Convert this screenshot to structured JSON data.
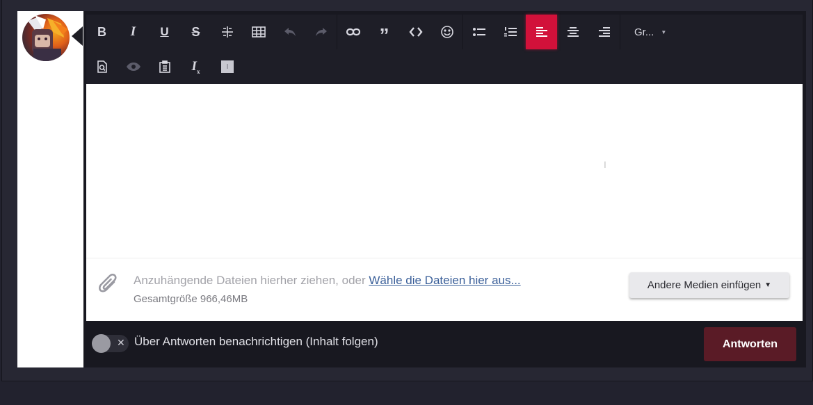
{
  "toolbar": {
    "font_dropdown_label": "Gr..."
  },
  "attachments": {
    "drop_text": "Anzuhängende Dateien hierher ziehen, oder ",
    "choose_link": "Wähle die Dateien hier aus...",
    "total_size": "Gesamtgröße 966,46MB",
    "media_button": "Andere Medien einfügen"
  },
  "footer": {
    "notify_label": "Über Antworten benachrichtigen (Inhalt folgen)",
    "reply_button": "Antworten"
  },
  "colors": {
    "active_align": "#d2113a",
    "reply_button": "#5a1b26",
    "link": "#3a5f99"
  }
}
